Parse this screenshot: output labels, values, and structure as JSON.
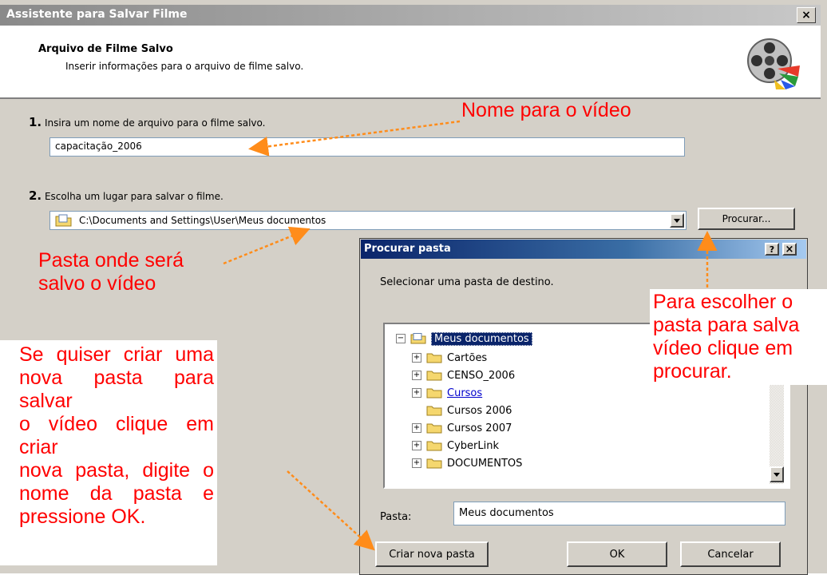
{
  "wizard": {
    "title": "Assistente para Salvar Filme",
    "close_label": "×",
    "header_title": "Arquivo de Filme Salvo",
    "header_subtitle": "Inserir informações para o arquivo de filme salvo.",
    "step1_num": "1.",
    "step1_label": "Insira um nome de arquivo para o filme salvo.",
    "filename_value": "capacitação_2006",
    "step2_num": "2.",
    "step2_label": "Escolha um lugar para salvar o filme.",
    "folder_value": "C:\\Documents and Settings\\User\\Meus documentos",
    "browse_button": "Procurar..."
  },
  "browse_dialog": {
    "title": "Procurar pasta",
    "help_label": "?",
    "close_label": "×",
    "instruction": "Selecionar uma pasta de destino.",
    "tree": {
      "root": "Meus documentos",
      "items": [
        "Cartões",
        "CENSO_2006",
        "Cursos",
        "Cursos 2006",
        "Cursos 2007",
        "CyberLink",
        "DOCUMENTOS"
      ]
    },
    "pasta_label": "Pasta:",
    "pasta_value": "Meus documentos",
    "new_folder_button": "Criar nova pasta",
    "ok_button": "OK",
    "cancel_button": "Cancelar"
  },
  "annotations": {
    "name_note": "Nome para o vídeo",
    "folder_note_line1": "Pasta onde será",
    "folder_note_line2": "salvo o vídeo",
    "browse_note_line1": "Para escolher o",
    "browse_note_line2": "pasta para salva",
    "browse_note_line3": "vídeo clique em",
    "browse_note_line4": "procurar.",
    "newfolder_note_line1": "Se quiser criar uma",
    "newfolder_note_line2": "nova pasta para salvar",
    "newfolder_note_line3": "o vídeo clique em criar",
    "newfolder_note_line4": "nova pasta, digite o",
    "newfolder_note_line5": "nome da pasta e",
    "newfolder_note_line6": "pressione OK."
  },
  "colors": {
    "annotation_red": "#ff0000",
    "arrow_orange": "#ff8c1a",
    "title_blue": "#0a246a"
  }
}
